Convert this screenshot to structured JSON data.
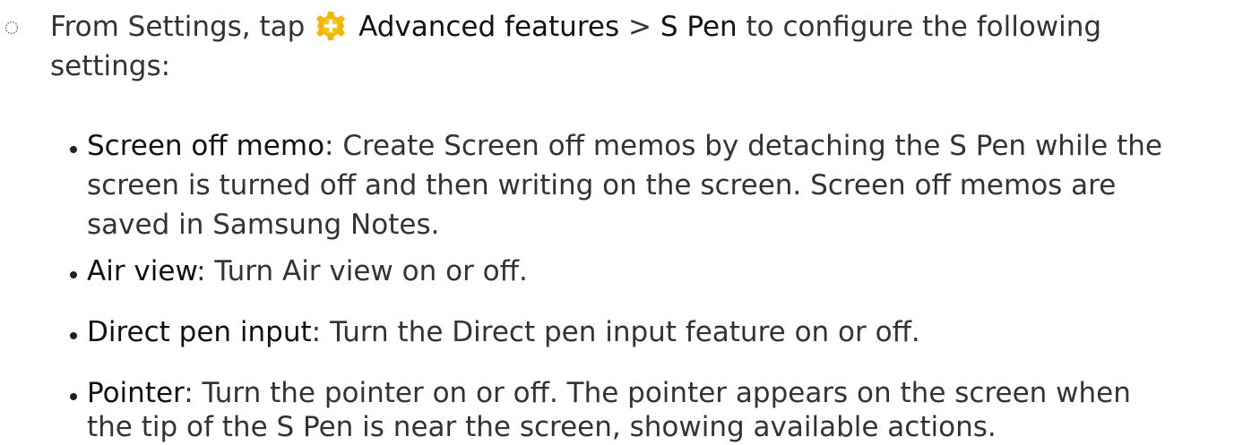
{
  "step": {
    "prefix": "From Settings, tap",
    "icon": "advanced-features-gear-icon",
    "path_part1": "Advanced features",
    "separator": ">",
    "path_part2": "S Pen",
    "suffix_line1": "to configure the following",
    "suffix_line2": "settings:"
  },
  "colors": {
    "text": "#333333",
    "icon_gold": "#f5b400",
    "icon_light": "#fcd34d"
  },
  "items": [
    {
      "term": "Screen off memo",
      "line1": ": Create Screen off memos by detaching the S Pen while the",
      "line2": "screen is turned off and then writing on the screen. Screen off memos are",
      "line3": "saved in Samsung Notes."
    },
    {
      "term": "Air view",
      "line1": ": Turn Air view on or off."
    },
    {
      "term": "Direct pen input",
      "line1": ": Turn the Direct pen input feature on or off."
    },
    {
      "term": "Pointer",
      "line1": ": Turn the pointer on or off. The pointer appears on the screen when",
      "line2": "the tip of the S Pen is near the screen, showing available actions."
    }
  ]
}
